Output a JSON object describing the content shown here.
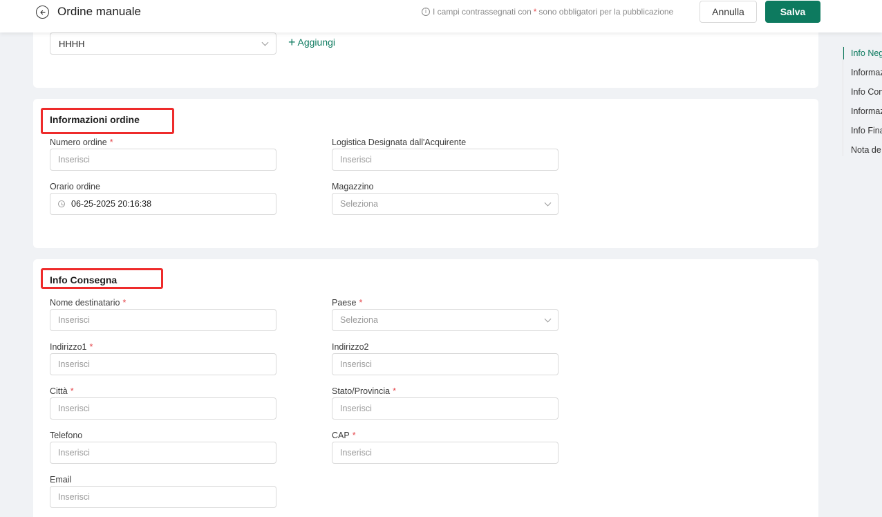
{
  "header": {
    "title": "Ordine manuale",
    "hint_prefix": "I campi contrassegnati con",
    "hint_star": "*",
    "hint_suffix": "sono obbligatori per la pubblicazione",
    "cancel_label": "Annulla",
    "save_label": "Salva"
  },
  "store": {
    "selected": "HHHH",
    "add_label": "Aggiungi"
  },
  "order_info": {
    "title": "Informazioni ordine",
    "fields": {
      "order_number": {
        "label": "Numero ordine",
        "required": "*",
        "placeholder": "Inserisci"
      },
      "buyer_logistics": {
        "label": "Logistica Designata dall'Acquirente",
        "placeholder": "Inserisci"
      },
      "order_time": {
        "label": "Orario ordine",
        "value": "06-25-2025 20:16:38"
      },
      "warehouse": {
        "label": "Magazzino",
        "placeholder": "Seleziona"
      }
    }
  },
  "delivery_info": {
    "title": "Info Consegna",
    "fields": {
      "recipient": {
        "label": "Nome destinatario",
        "required": "*",
        "placeholder": "Inserisci"
      },
      "country": {
        "label": "Paese",
        "required": "*",
        "placeholder": "Seleziona"
      },
      "address1": {
        "label": "Indirizzo1",
        "required": "*",
        "placeholder": "Inserisci"
      },
      "address2": {
        "label": "Indirizzo2",
        "placeholder": "Inserisci"
      },
      "city": {
        "label": "Città",
        "required": "*",
        "placeholder": "Inserisci"
      },
      "state": {
        "label": "Stato/Provincia",
        "required": "*",
        "placeholder": "Inserisci"
      },
      "phone": {
        "label": "Telefono",
        "placeholder": "Inserisci"
      },
      "zip": {
        "label": "CAP",
        "required": "*",
        "placeholder": "Inserisci"
      },
      "email": {
        "label": "Email",
        "placeholder": "Inserisci"
      }
    }
  },
  "anchor_nav": {
    "items": [
      "Info Neg",
      "Informaz",
      "Info Con",
      "Informaz",
      "Info Fina",
      "Nota de"
    ]
  },
  "colors": {
    "accent": "#0d7a5f",
    "highlight": "#ee2b2b",
    "required": "#e5484d"
  }
}
